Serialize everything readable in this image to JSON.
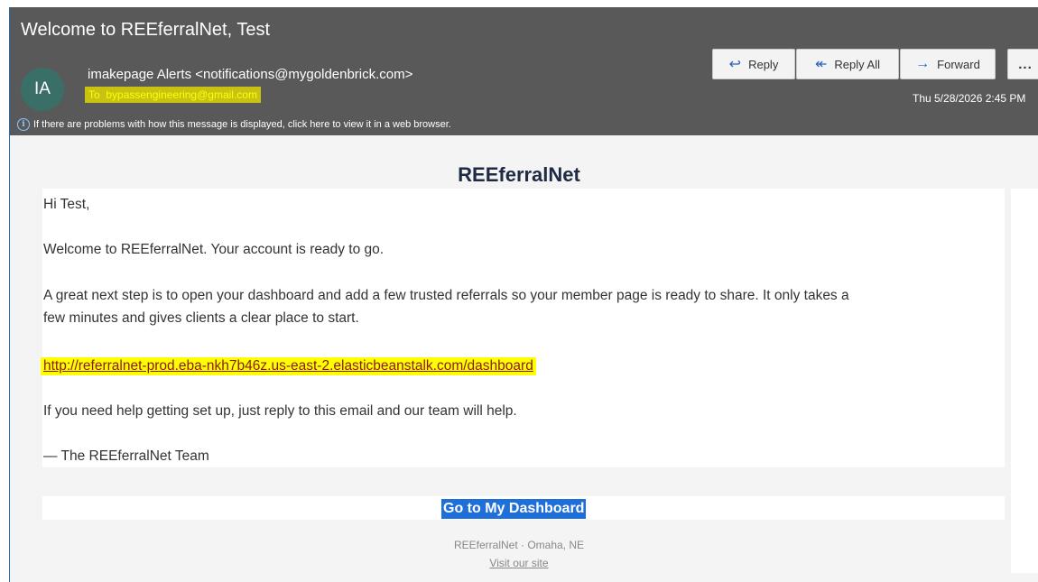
{
  "email": {
    "subject": "Welcome to REEferralNet, Test",
    "avatar_initials": "IA",
    "sender": "imakepage Alerts <notifications@mygoldenbrick.com>",
    "recipient_label": "To",
    "recipient": "bypassengineering@gmail.com",
    "info_text": "If there are problems with how this message is displayed, click here to view it in a web browser.",
    "datetime": "Thu 5/28/2026 2:45 PM"
  },
  "actions": {
    "reply": "Reply",
    "reply_all": "Reply All",
    "forward": "Forward",
    "more": "..."
  },
  "icons": {
    "reply": "reply-arrow-icon",
    "reply_all": "reply-all-arrow-icon",
    "forward": "forward-arrow-icon",
    "info": "info-icon"
  },
  "message": {
    "brand": "REEferralNet",
    "greeting": "Hi Test,",
    "welcome": "Welcome to REEferralNet. Your account is ready to go.",
    "next_step_line1": "A great next step is to open your dashboard and add a few trusted referrals so your member page is ready to share. It only takes a",
    "next_step_line2": "few minutes and gives clients a clear place to start.",
    "link": "http://referralnet-prod.eba-nkh7b46z.us-east-2.elasticbeanstalk.com/dashboard",
    "help": "If you need help getting set up, just reply to this email and our team will help.",
    "signoff": "— The REEferralNet Team",
    "cta": "Go to My Dashboard",
    "footer_location": "REEferralNet · Omaha, NE",
    "footer_link": "Visit our site"
  },
  "colors": {
    "header_bg": "#595959",
    "highlight": "#ffff00",
    "cta_bg": "#1f6fd9",
    "accent": "#2a63b8"
  }
}
